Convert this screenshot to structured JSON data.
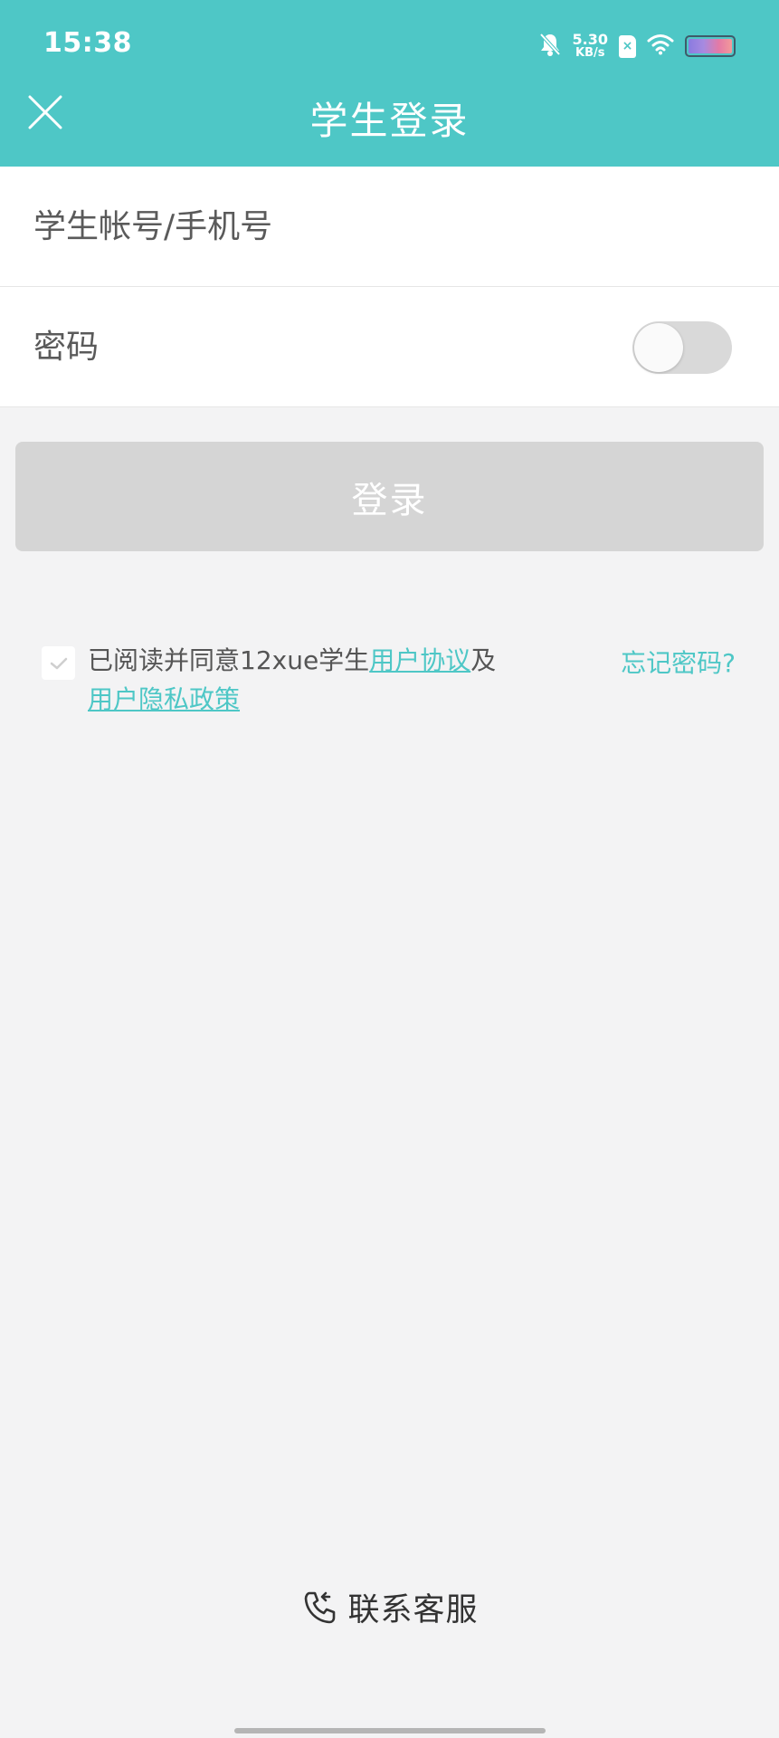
{
  "status_bar": {
    "time": "15:38",
    "network_speed_value": "5.30",
    "network_speed_unit": "KB/s",
    "icons": [
      "bell-muted-icon",
      "sim-icon",
      "wifi-icon",
      "battery-icon"
    ]
  },
  "header": {
    "title": "学生登录",
    "close_icon": "close-icon"
  },
  "form": {
    "account": {
      "placeholder": "学生帐号/手机号",
      "value": ""
    },
    "password": {
      "placeholder": "密码",
      "value": "",
      "show_password_toggle": false
    }
  },
  "login_button": {
    "label": "登录",
    "enabled": false
  },
  "agreement": {
    "checked": true,
    "prefix": "已阅读并同意12xue学生",
    "link_user_agreement": "用户协议",
    "connector": "及",
    "link_privacy_policy": "用户隐私政策"
  },
  "forgot_password": "忘记密码?",
  "customer_service": {
    "label": "联系客服",
    "icon": "phone-call-icon"
  },
  "colors": {
    "accent": "#4ec7c6",
    "background": "#f3f3f4",
    "button_disabled": "#d5d5d5"
  }
}
